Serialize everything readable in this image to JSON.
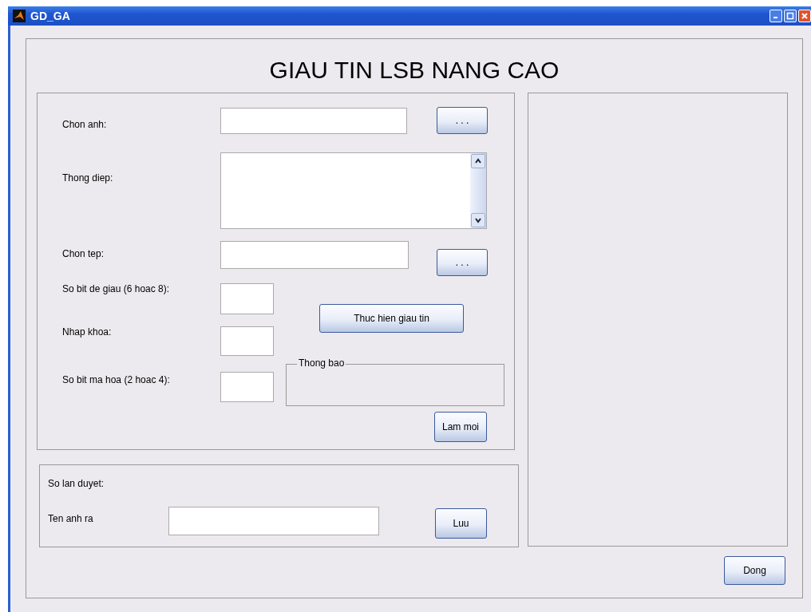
{
  "window": {
    "title": "GD_GA"
  },
  "heading": "GIAU TIN LSB NANG CAO",
  "input_panel": {
    "image": {
      "label": "Chon anh:",
      "browse": ". . ."
    },
    "message": {
      "label": "Thong diep:"
    },
    "file": {
      "label": "Chon tep:",
      "browse": ". . ."
    },
    "hide_bits": {
      "label": "So bit de giau (6 hoac 8):"
    },
    "key": {
      "label": "Nhap khoa:"
    },
    "encrypt_bits": {
      "label": "So bit ma hoa (2 hoac 4):"
    },
    "run_button": "Thuc hien giau tin",
    "notice": {
      "title": "Thong bao"
    },
    "reset_button": "Lam moi"
  },
  "output_panel": {
    "iterations_label": "So lan duyet:",
    "output_name": {
      "label": "Ten anh ra"
    },
    "save_button": "Luu"
  },
  "close_button": "Dong"
}
